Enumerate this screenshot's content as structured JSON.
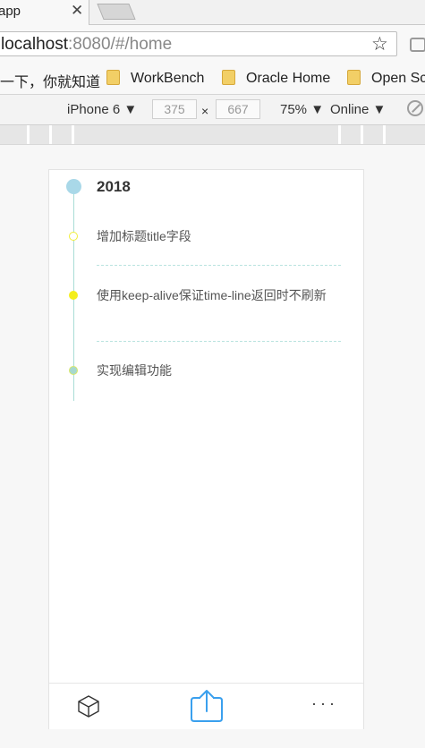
{
  "browser": {
    "tab_title": "-app",
    "tab_close": "✕",
    "url_host": "localhost",
    "url_rest": ":8080/#/home",
    "bookmarks": [
      {
        "label": "一下，你就知道",
        "folder": false
      },
      {
        "label": "WorkBench",
        "folder": true
      },
      {
        "label": "Oracle Home",
        "folder": true
      },
      {
        "label": "Open Sc",
        "folder": true
      }
    ]
  },
  "devtools": {
    "device": "iPhone 6",
    "width": "375",
    "times": "×",
    "height": "667",
    "zoom": "75%",
    "network": "Online",
    "caret": "▼"
  },
  "timeline": {
    "year": "2018",
    "items": [
      {
        "text": "增加标题title字段",
        "dot_fill": "#ffffff",
        "dot_border": "#f0ee3a"
      },
      {
        "text": "使用keep-alive保证time-line返回时不刷新",
        "dot_fill": "#f4ee1c",
        "dot_border": "#f4ee1c"
      },
      {
        "text": "实现编辑功能",
        "dot_fill": "#a6d8cf",
        "dot_border": "#d8e86a"
      }
    ]
  },
  "bottom_nav": {
    "left_icon": "cube-icon",
    "center_icon": "share-icon",
    "center_color": "#3aa0ee",
    "more": "···"
  }
}
